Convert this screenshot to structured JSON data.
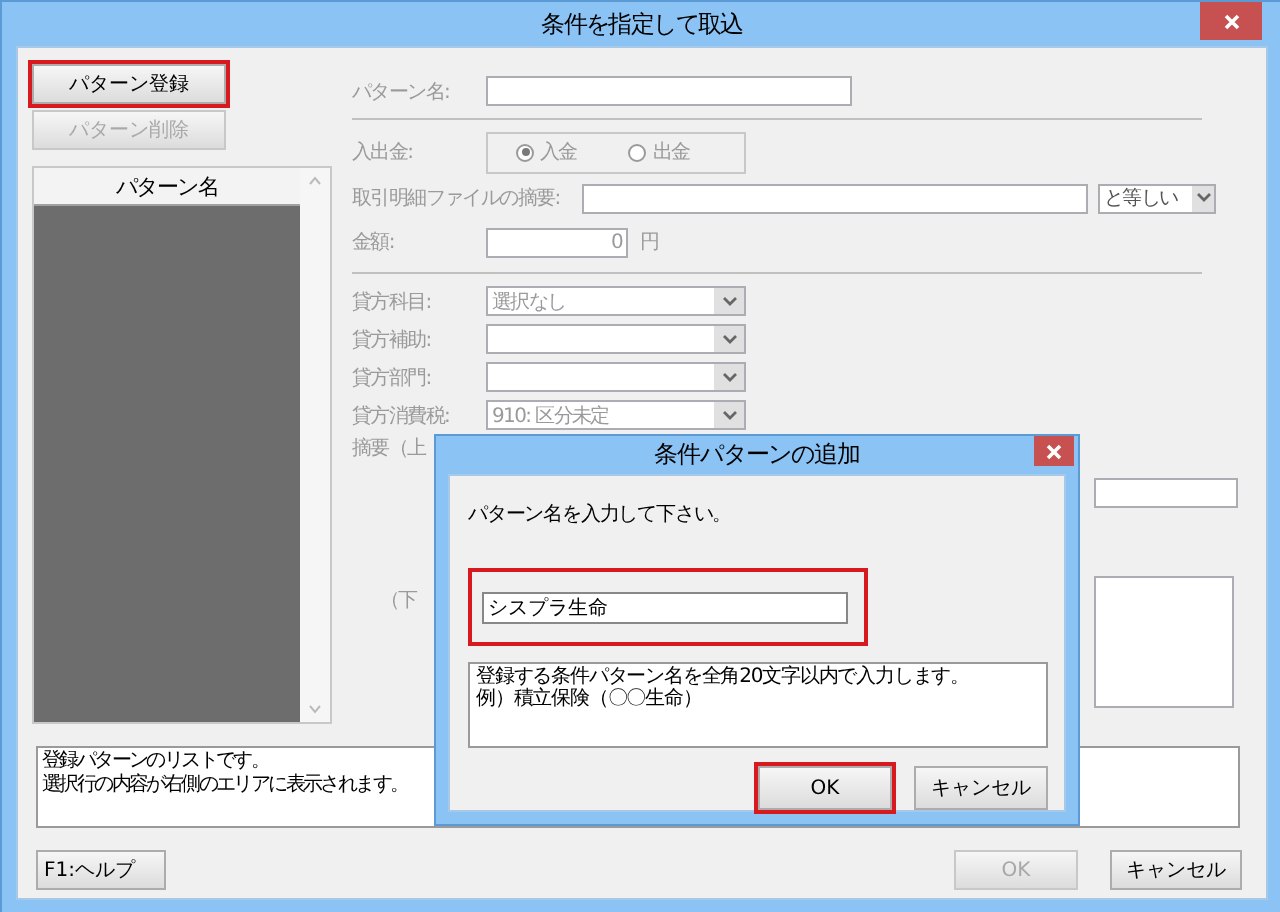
{
  "window": {
    "title": "条件を指定して取込"
  },
  "pattern_buttons": [
    {
      "label": "パターン登録",
      "disabled": false,
      "highlighted": true
    },
    {
      "label": "パターン削除",
      "disabled": true,
      "highlighted": false
    }
  ],
  "pattern_list": {
    "header": "パターン名"
  },
  "form": {
    "disabled": true,
    "pattern_name": {
      "label": "パターン名:"
    },
    "direction": {
      "label": "入出金:",
      "options": [
        {
          "label": "入金",
          "selected": true
        },
        {
          "label": "出金",
          "selected": false
        }
      ]
    },
    "summary": {
      "label": "取引明細ファイルの摘要:",
      "match": "と等しい"
    },
    "amount": {
      "label": "金額:",
      "value": "0",
      "unit": "円"
    },
    "credit_fields": [
      {
        "label": "貸方科目:",
        "value": "選択なし"
      },
      {
        "label": "貸方補助:"
      },
      {
        "label": "貸方部門:"
      },
      {
        "label": "貸方消費税:",
        "value": "910: 区分未定"
      }
    ],
    "memo_upper_label": "摘要（上",
    "memo_lower_label": "（下"
  },
  "help_text": [
    "登録パターンのリストです。",
    "選択行の内容が右側のエリアに表示されます。"
  ],
  "bottom_buttons": [
    {
      "label": "F1:ヘルプ",
      "disabled": false
    },
    {
      "label": "OK",
      "disabled": true
    },
    {
      "label": "キャンセル",
      "disabled": false
    }
  ],
  "dialog": {
    "title": "条件パターンの追加",
    "prompt": "パターン名を入力して下さい。",
    "name_field": {
      "value": "シスプラ生命",
      "highlighted": true
    },
    "hint": [
      "登録する条件パターン名を全角20文字以内で入力します。",
      "例）積立保険（〇〇生命）"
    ],
    "buttons": [
      {
        "label": "OK",
        "highlighted": true
      },
      {
        "label": "キャンセル",
        "highlighted": false
      }
    ]
  }
}
